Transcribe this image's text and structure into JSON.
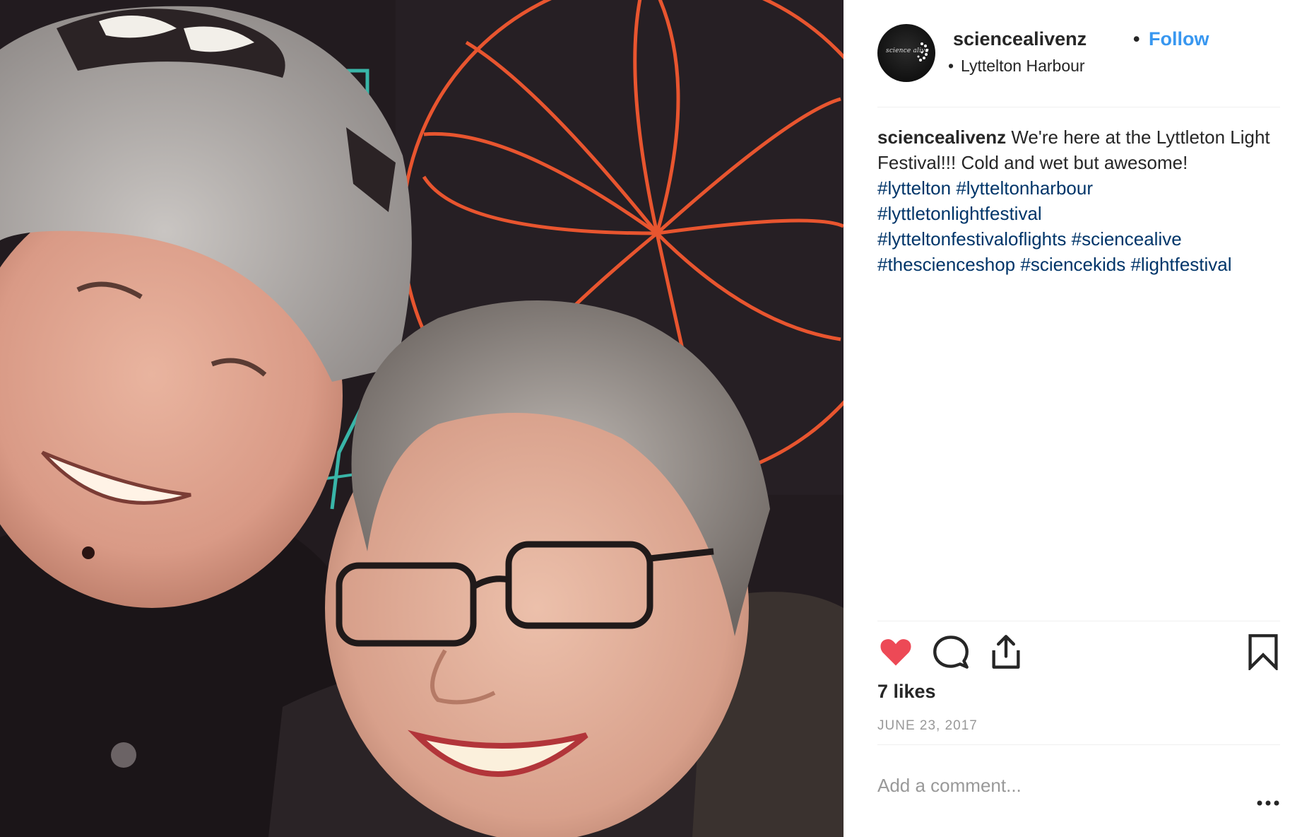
{
  "post": {
    "username": "sciencealivenz",
    "separator": "•",
    "follow_label": "Follow",
    "location_bullet": "•",
    "location": "Lyttelton Harbour",
    "avatar_text": "science alive"
  },
  "caption": {
    "username": "sciencealivenz",
    "text": "We're here at the Lyttleton Light Festival!!! Cold and wet but awesome!",
    "hashtags": [
      "#lyttelton",
      "#lytteltonharbour",
      "#lyttletonlightfestival",
      "#lytteltonfestivaloflights",
      "#sciencealive",
      "#thescienceshop",
      "#sciencekids",
      "#lightfestival"
    ]
  },
  "actions": {
    "like_icon": "heart-filled-icon",
    "comment_icon": "comment-bubble-icon",
    "share_icon": "share-upload-icon",
    "save_icon": "bookmark-icon",
    "like_color": "#ed4956"
  },
  "likes": "7 likes",
  "date": "JUNE 23, 2017",
  "comment": {
    "placeholder": "Add a comment...",
    "more_icon": "more-options-icon"
  },
  "colors": {
    "link": "#3897f0",
    "hashtag": "#003569",
    "muted": "#999999"
  }
}
